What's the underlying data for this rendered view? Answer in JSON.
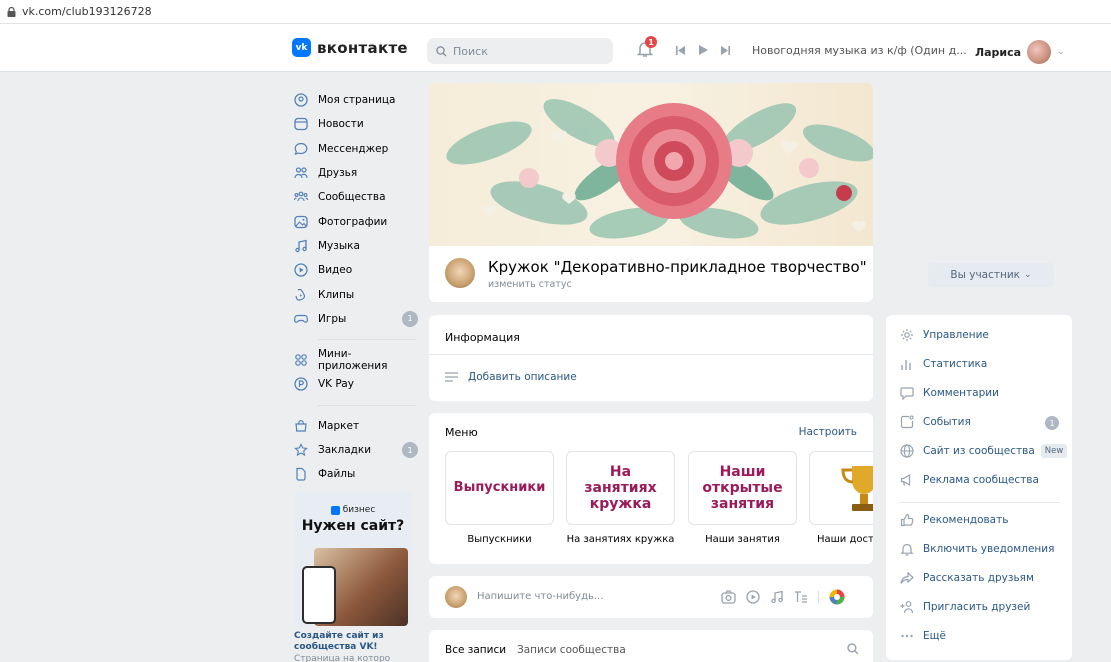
{
  "browser": {
    "url": "vk.com/club193126728"
  },
  "header": {
    "logo_text": "вконтакте",
    "logo_badge": "vk",
    "search_placeholder": "Поиск",
    "notif_count": "1",
    "track": "Новогодняя музыка из к/ф (Один д...",
    "user_name": "Лариса"
  },
  "nav": {
    "items": [
      {
        "label": "Моя страница",
        "icon": "user-circle-icon"
      },
      {
        "label": "Новости",
        "icon": "news-icon"
      },
      {
        "label": "Мессенджер",
        "icon": "message-icon"
      },
      {
        "label": "Друзья",
        "icon": "friends-icon"
      },
      {
        "label": "Сообщества",
        "icon": "groups-icon"
      },
      {
        "label": "Фотографии",
        "icon": "photo-icon"
      },
      {
        "label": "Музыка",
        "icon": "music-icon"
      },
      {
        "label": "Видео",
        "icon": "video-icon"
      },
      {
        "label": "Клипы",
        "icon": "clips-icon"
      },
      {
        "label": "Игры",
        "icon": "games-icon",
        "badge": "1"
      }
    ],
    "items2": [
      {
        "label": "Мини-приложения",
        "icon": "apps-icon"
      },
      {
        "label": "VK Pay",
        "icon": "vkpay-icon"
      }
    ],
    "items3": [
      {
        "label": "Маркет",
        "icon": "market-icon"
      },
      {
        "label": "Закладки",
        "icon": "bookmark-icon",
        "badge": "1"
      },
      {
        "label": "Файлы",
        "icon": "file-icon"
      }
    ]
  },
  "promo": {
    "brand": "бизнес",
    "headline": "Нужен сайт?",
    "caption": "Создайте сайт из сообщества VK!",
    "subcaption": "Страница на которо"
  },
  "group": {
    "name": "Кружок \"Декоративно-прикладное творчество\"",
    "status": "изменить статус",
    "member_button": "Вы участник"
  },
  "info": {
    "title": "Информация",
    "add_description": "Добавить описание"
  },
  "menu": {
    "title": "Меню",
    "setup": "Настроить",
    "tiles": [
      {
        "image_text": "Выпускники",
        "caption": "Выпускники"
      },
      {
        "image_text": "На занятиях кружка",
        "caption": "На занятиях кружка"
      },
      {
        "image_text": "Наши открытые занятия",
        "caption": "Наши занятия"
      },
      {
        "image_text": "",
        "caption": "Наши дости"
      }
    ]
  },
  "post": {
    "placeholder": "Напишите что-нибудь..."
  },
  "wall_tabs": {
    "all": "Все записи",
    "community": "Записи сообщества"
  },
  "side_menu": {
    "items": [
      {
        "label": "Управление",
        "icon": "gear-icon"
      },
      {
        "label": "Статистика",
        "icon": "stats-icon"
      },
      {
        "label": "Комментарии",
        "icon": "comment-icon"
      },
      {
        "label": "События",
        "icon": "event-icon",
        "badge": "1"
      },
      {
        "label": "Сайт из сообщества",
        "icon": "globe-icon",
        "tag": "New"
      },
      {
        "label": "Реклама сообщества",
        "icon": "megaphone-icon"
      },
      {
        "label": "Рекомендовать",
        "icon": "thumbs-up-icon"
      },
      {
        "label": "Включить уведомления",
        "icon": "bell-icon"
      },
      {
        "label": "Рассказать друзьям",
        "icon": "share-icon"
      },
      {
        "label": "Пригласить друзей",
        "icon": "invite-icon"
      },
      {
        "label": "Ещё",
        "icon": "more-icon"
      }
    ]
  },
  "colors": {
    "accent": "#0077ff",
    "link": "#2a5885",
    "background": "#edeef0",
    "tile_text": "#9b1a5a"
  }
}
